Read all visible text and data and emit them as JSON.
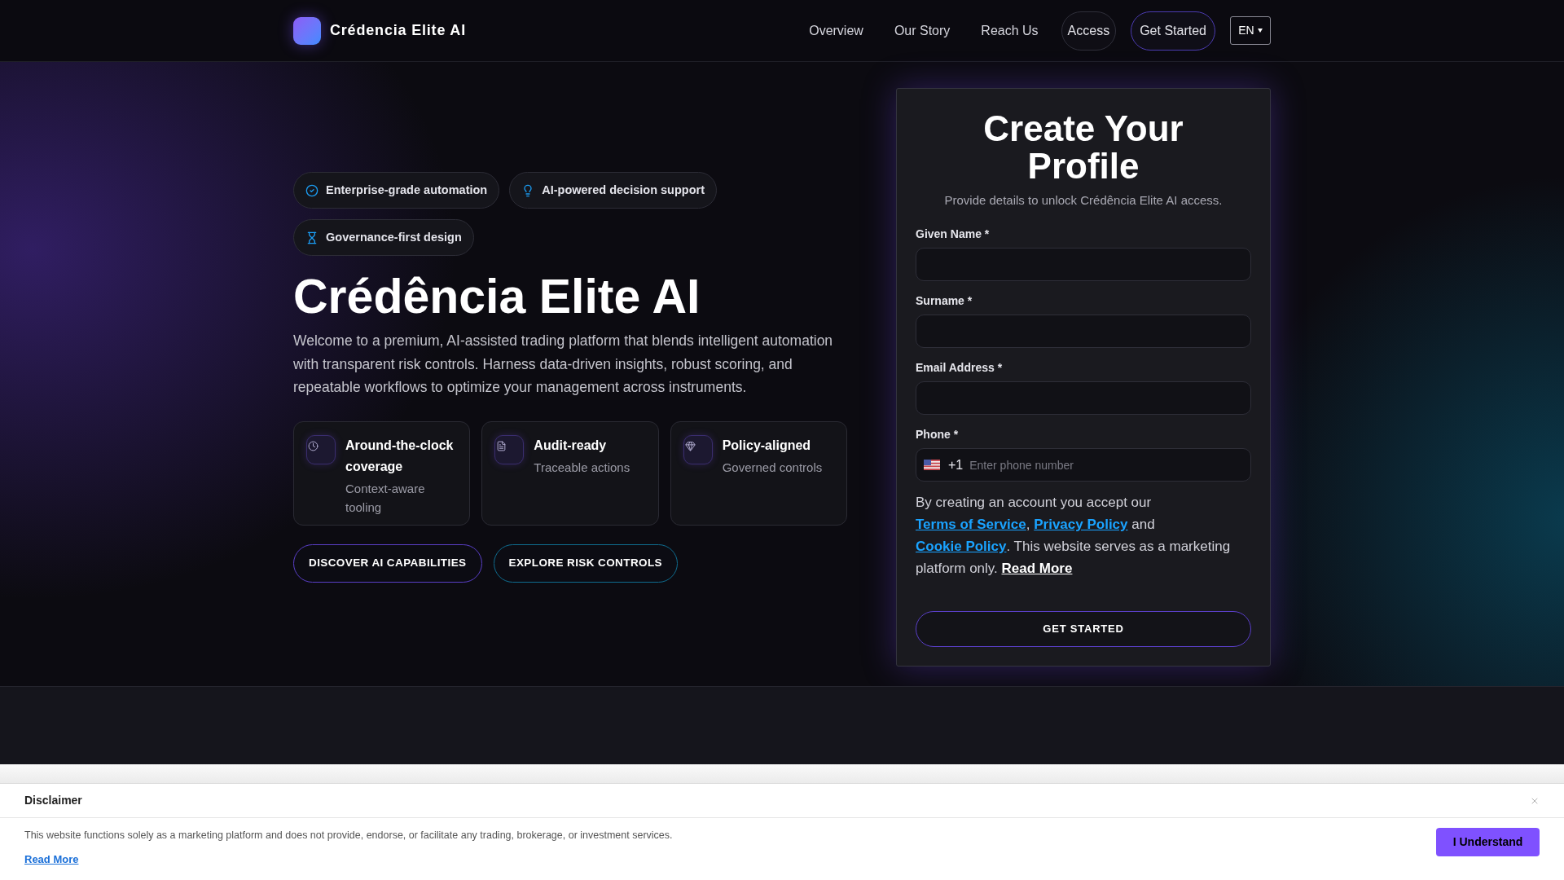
{
  "header": {
    "brand": "Crédencia Elite AI",
    "nav": [
      {
        "label": "Overview",
        "kind": "link"
      },
      {
        "label": "Our Story",
        "kind": "link"
      },
      {
        "label": "Reach Us",
        "kind": "link"
      },
      {
        "label": "Access",
        "kind": "outline"
      },
      {
        "label": "Get Started",
        "kind": "accent"
      }
    ],
    "language": "EN"
  },
  "hero": {
    "chips": [
      "Enterprise-grade automation",
      "AI-powered decision support",
      "Governance-first design"
    ],
    "title": "Crédência Elite AI",
    "intro": "Welcome to a premium, AI-assisted trading platform that blends intelligent automation with transparent risk controls. Harness data-driven insights, robust scoring, and repeatable workflows to optimize your management across instruments.",
    "features": [
      {
        "title": "Around-the-clock coverage",
        "description": "Context-aware tooling"
      },
      {
        "title": "Audit-ready",
        "description": "Traceable actions"
      },
      {
        "title": "Policy-aligned",
        "description": "Governed controls"
      }
    ],
    "buttons": [
      {
        "label": "DISCOVER AI CAPABILITIES",
        "kind": "primary"
      },
      {
        "label": "EXPLORE RISK CONTROLS",
        "kind": "secondary"
      }
    ]
  },
  "form": {
    "title": "Create Your Profile",
    "subtitle": "Provide details to unlock Crédência Elite AI access.",
    "fields": [
      {
        "label": "Given Name *",
        "kind": "text"
      },
      {
        "label": "Surname *",
        "kind": "text"
      },
      {
        "label": "Email Address *",
        "kind": "email"
      },
      {
        "label": "Phone *",
        "kind": "phone",
        "dial_code": "+1",
        "placeholder": "Enter phone number"
      }
    ],
    "consent": [
      {
        "kind": "text",
        "text": "By creating an account you accept our "
      },
      {
        "kind": "link",
        "text": "Terms of Service"
      },
      {
        "kind": "text",
        "text": ", "
      },
      {
        "kind": "link",
        "text": "Privacy Policy"
      },
      {
        "kind": "text",
        "text": " and "
      },
      {
        "kind": "link",
        "text": "Cookie Policy"
      },
      {
        "kind": "text",
        "text": ". This website serves as a marketing platform only. "
      },
      {
        "kind": "plain-link",
        "text": "Read More"
      }
    ],
    "submit": "GET STARTED"
  },
  "disclaimer": {
    "title": "Disclaimer",
    "text": "This website functions solely as a marketing platform and does not provide, endorse, or facilitate any trading, brokerage, or investment services.",
    "link": "Read More",
    "button": "I Understand"
  }
}
